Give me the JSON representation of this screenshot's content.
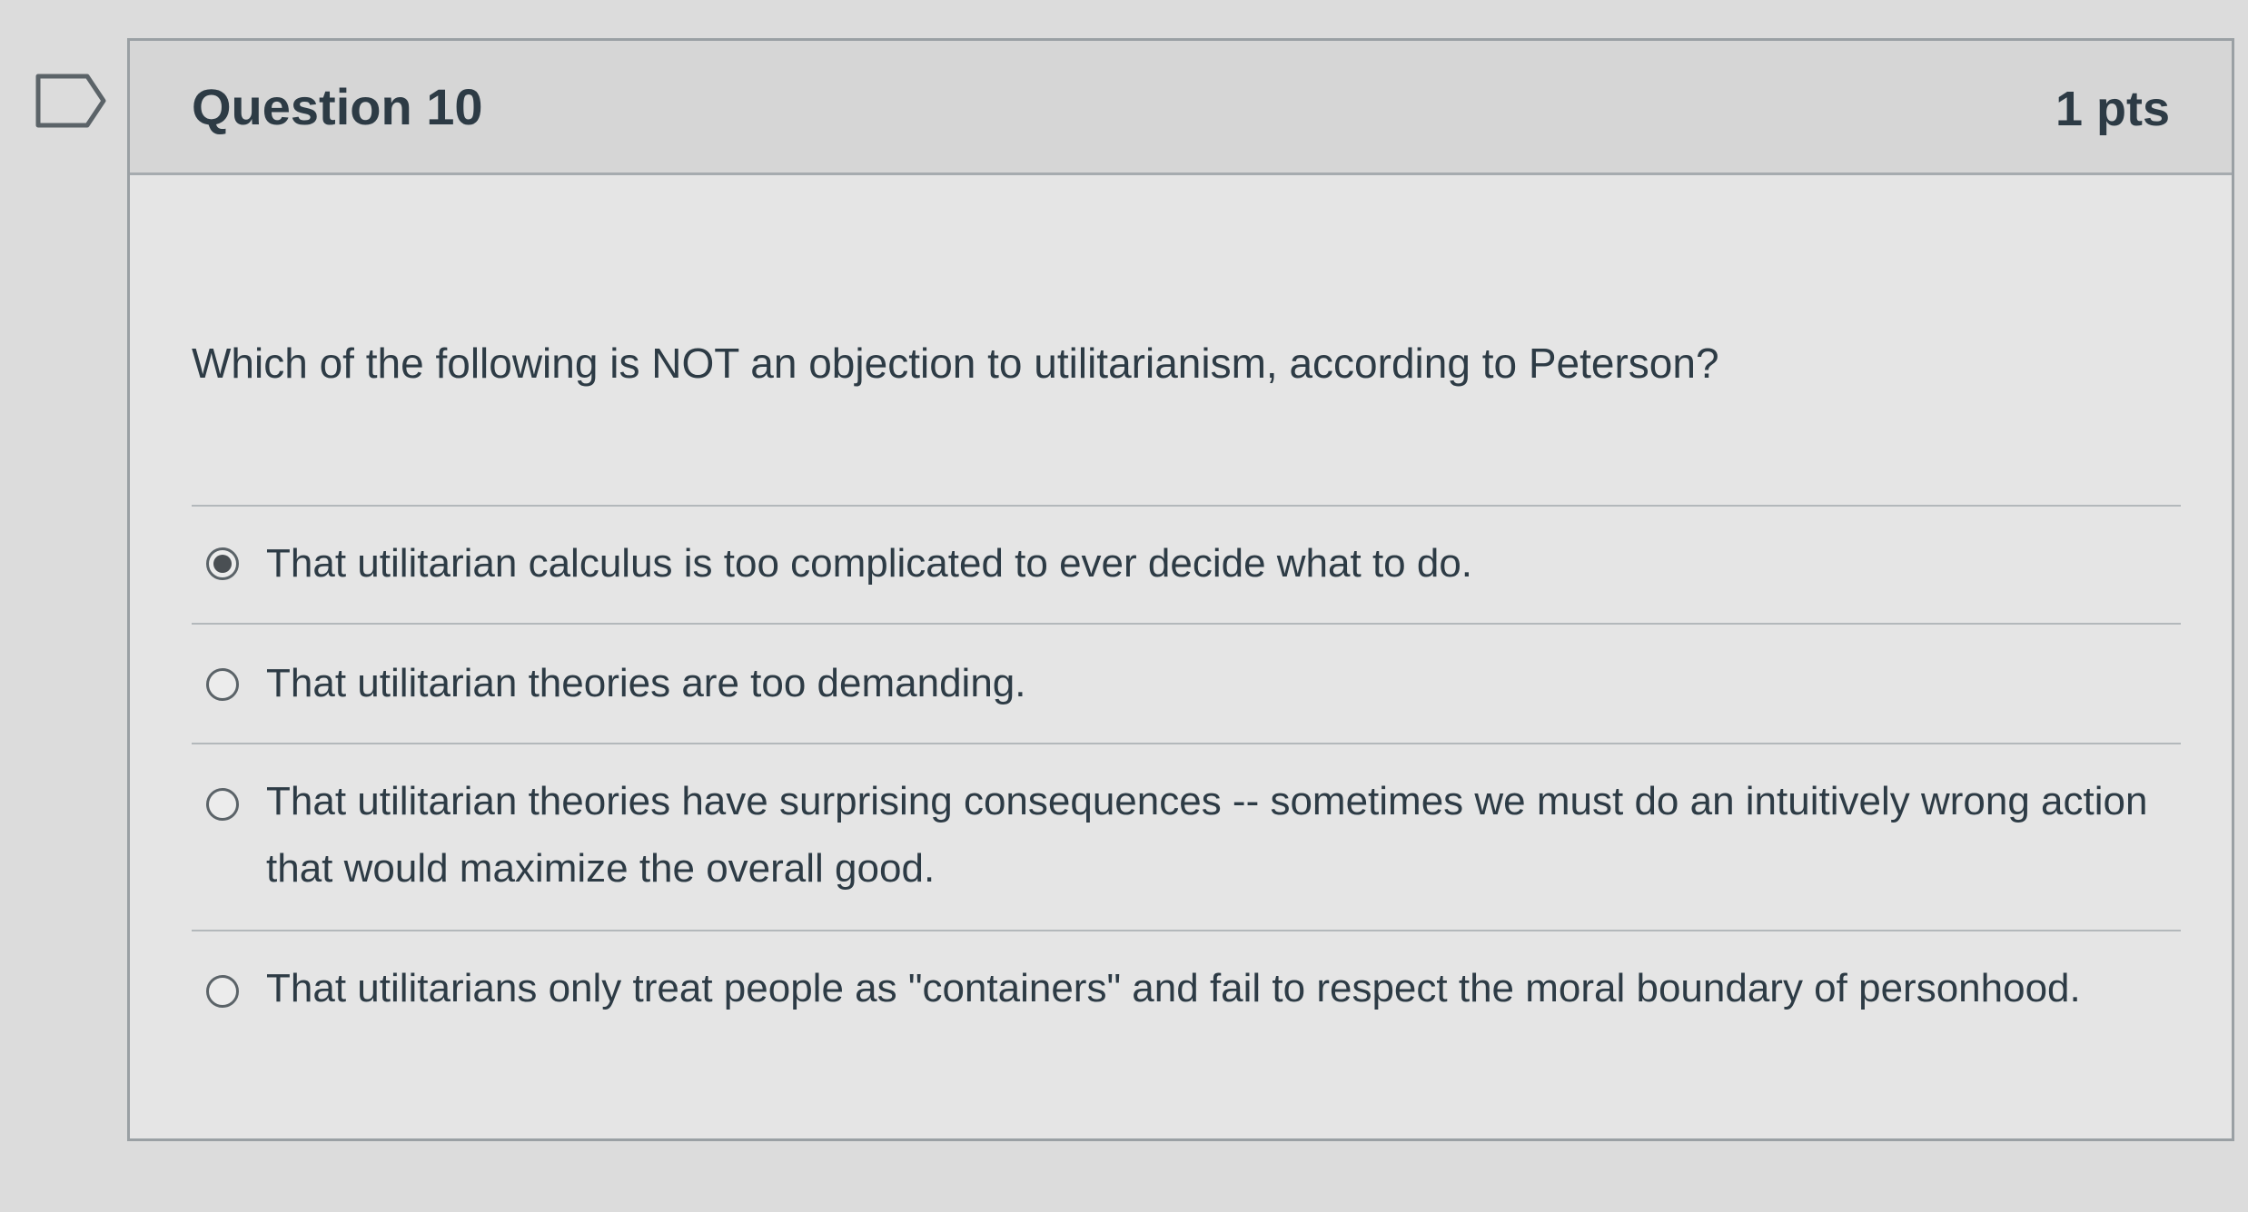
{
  "question": {
    "title": "Question 10",
    "points": "1 pts",
    "text": "Which of the following is NOT an objection to utilitarianism, according to Peterson?",
    "flag_icon": "flag-outline-icon",
    "answers": [
      {
        "label": "That utilitarian calculus is too complicated to ever decide what to do.",
        "selected": true
      },
      {
        "label": "That utilitarian theories are too demanding.",
        "selected": false
      },
      {
        "label": "That utilitarian theories have surprising consequences -- sometimes we must do an intuitively wrong action that would maximize the overall good.",
        "selected": false
      },
      {
        "label": "That utilitarians only treat people as \"containers\" and fail to respect the moral boundary of personhood.",
        "selected": false
      }
    ]
  },
  "colors": {
    "page_background": "#dcdcdc",
    "header_background": "#d6d6d6",
    "text": "#2d3b45",
    "border": "#9aa0a4"
  }
}
